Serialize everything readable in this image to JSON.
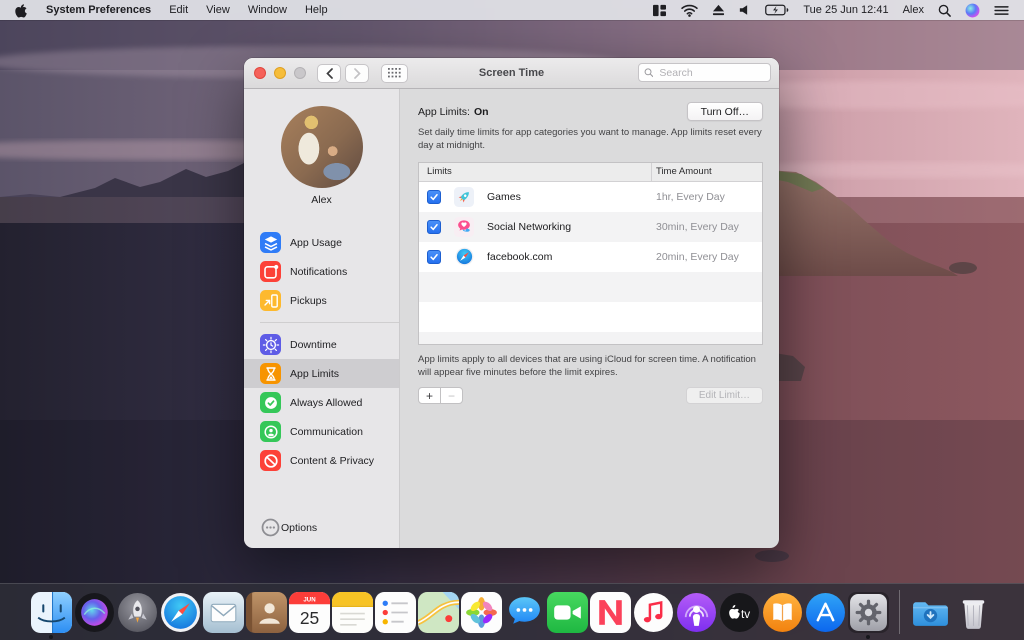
{
  "menu_bar": {
    "app_name": "System Preferences",
    "menus": [
      "Edit",
      "View",
      "Window",
      "Help"
    ],
    "datetime": "Tue 25 Jun 12:41",
    "user": "Alex"
  },
  "window": {
    "title": "Screen Time",
    "search_placeholder": "Search"
  },
  "sidebar": {
    "user_name": "Alex",
    "items": [
      {
        "label": "App Usage",
        "color": "#2f7cf7",
        "selected": false
      },
      {
        "label": "Notifications",
        "color": "#fc4138",
        "selected": false
      },
      {
        "label": "Pickups",
        "color": "#fdb92e",
        "selected": false
      },
      {
        "label": "Downtime",
        "color": "#5e5ce6",
        "selected": false
      },
      {
        "label": "App Limits",
        "color": "#f79400",
        "selected": true
      },
      {
        "label": "Always Allowed",
        "color": "#35c759",
        "selected": false
      },
      {
        "label": "Communication",
        "color": "#35c759",
        "selected": false
      },
      {
        "label": "Content & Privacy",
        "color": "#fc4138",
        "selected": false
      }
    ],
    "options_label": "Options"
  },
  "app_limits": {
    "heading_label": "App Limits:",
    "heading_state": "On",
    "turn_off_label": "Turn Off…",
    "description": "Set daily time limits for app categories you want to manage. App limits reset every day at midnight.",
    "columns": [
      "Limits",
      "Time Amount"
    ],
    "rows": [
      {
        "app": "Games",
        "time": "1hr, Every Day",
        "checked": true,
        "icon": "games-rocket-icon"
      },
      {
        "app": "Social Networking",
        "time": "30min, Every Day",
        "checked": true,
        "icon": "social-bubble-icon"
      },
      {
        "app": "facebook.com",
        "time": "20min, Every Day",
        "checked": true,
        "icon": "safari-compass-icon"
      }
    ],
    "footnote": "App limits apply to all devices that are using iCloud for screen time. A notification will appear five minutes before the limit expires.",
    "add_label": "+",
    "remove_label": "−",
    "edit_limit_label": "Edit Limit…"
  },
  "dock": {
    "apps": [
      "Finder",
      "Siri",
      "Launchpad",
      "Safari",
      "Mail",
      "Contacts",
      "Calendar",
      "Notes",
      "Reminders",
      "Maps",
      "Photos",
      "Messages",
      "FaceTime",
      "News",
      "Music",
      "Podcasts",
      "TV",
      "Books",
      "App Store",
      "System Preferences",
      "Downloads",
      "Trash"
    ],
    "running_apps": [
      "Finder",
      "System Preferences"
    ],
    "calendar": {
      "month": "JUN",
      "day": "25"
    },
    "tv_label": "tv"
  },
  "colors": {
    "checkbox_blue": "#2d7cf7",
    "sidebar_selected": "#cecdd0",
    "menu_bar_bg": "#e0e1e7",
    "window_bg": "#dbdbdc",
    "dock_bg": "#2e2e38"
  }
}
